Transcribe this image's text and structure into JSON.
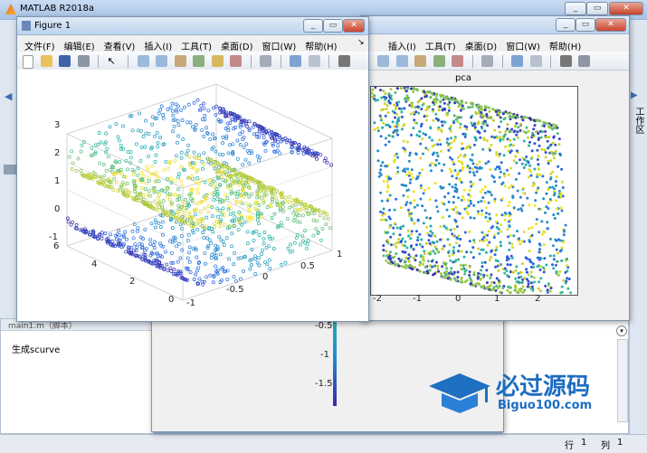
{
  "matlab": {
    "title": "MATLAB R2018a",
    "menu": [
      "窗口(W)",
      "帮助(H)"
    ],
    "side_label": "工作区",
    "editor_tab": "main1.m（脚本）",
    "command_text": "生成scurve",
    "status": {
      "row_label": "行",
      "row_value": "1",
      "col_label": "列",
      "col_value": "1"
    }
  },
  "figure1": {
    "title": "Figure 1",
    "menu": [
      "文件(F)",
      "编辑(E)",
      "查看(V)",
      "插入(I)",
      "工具(T)",
      "桌面(D)",
      "窗口(W)",
      "帮助(H)"
    ]
  },
  "figure2": {
    "menu": [
      "插入(I)",
      "工具(T)",
      "桌面(D)",
      "窗口(W)",
      "帮助(H)"
    ]
  },
  "chart_data": [
    {
      "type": "scatter",
      "title": "",
      "projection": "3d",
      "xlim": [
        -1,
        1
      ],
      "ylim": [
        0,
        6
      ],
      "zlim": [
        -1,
        3
      ],
      "xticks": [
        "-1",
        "-0.5",
        "0",
        "0.5",
        "1"
      ],
      "yticks": [
        "0",
        "2",
        "4",
        "6"
      ],
      "zticks": [
        "-1",
        "0",
        "1",
        "2",
        "3"
      ],
      "marker": "open-circle",
      "colormap": "parula",
      "grid": true
    },
    {
      "type": "scatter",
      "title": "pca",
      "xlim": [
        -2.6,
        3
      ],
      "xticks": [
        "-2",
        "-1",
        "0",
        "1",
        "2"
      ],
      "marker": "filled-dot",
      "colormap": "parula"
    },
    {
      "type": "colorbar",
      "ticks": [
        "-0.5",
        "-1",
        "-1.5"
      ]
    }
  ],
  "watermark": {
    "text": "必过源码",
    "subtext": "Biguo100.com"
  },
  "colors": {
    "parula_low": "#3e26a8",
    "parula_mid": "#25b8a3",
    "parula_high": "#f9e41e",
    "frame": "#7f95b3"
  }
}
